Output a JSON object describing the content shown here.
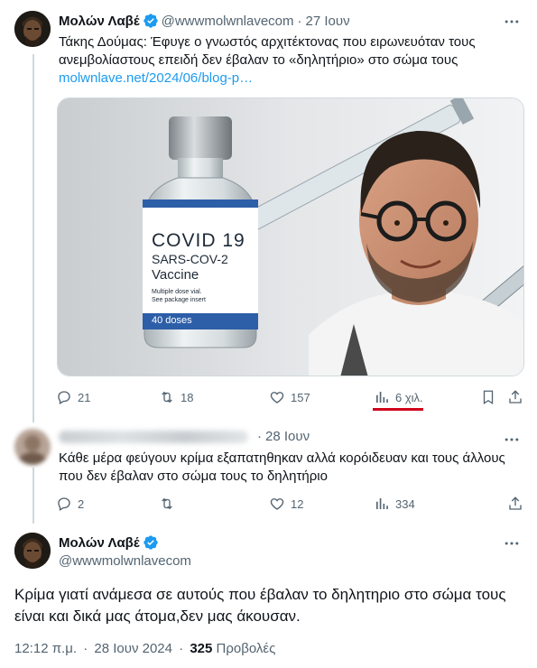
{
  "tweet1": {
    "name": "Μολών Λαβέ",
    "handle": "@wwwmolwnlavecom",
    "dot": "·",
    "date": "27 Ιουν",
    "text": "Τάκης Δούμας: Έφυγε ο γνωστός αρχιτέκτονας που ειρωνευόταν τους ανεμβολίαστους επειδή δεν έβαλαν το «δηλητήριο» στο σώμα τους",
    "link": "molwnlave.net/2024/06/blog-p…",
    "media": {
      "vial_line1": "COVID 19",
      "vial_line2": "SARS-COV-2",
      "vial_line3": "Vaccine",
      "vial_small1": "Multiple dose vial.",
      "vial_small2": "See package insert",
      "vial_doses": "40 doses"
    },
    "replies": "21",
    "retweets": "18",
    "likes": "157",
    "views": "6 χιλ."
  },
  "tweet2": {
    "date": "28 Ιουν",
    "dot": "·",
    "text": "Κάθε μέρα φεύγουν κρίμα εξαπατηθηκαν αλλά κορόιδευαν και τους άλλους που δεν έβαλαν στο σώμα τους το δηλητήριο",
    "replies": "2",
    "retweets": "",
    "likes": "12",
    "views": "334"
  },
  "tweet3": {
    "name": "Μολών Λαβέ",
    "handle": "@wwwmolwnlavecom",
    "text": "Κρίμα γιατί ανάμεσα σε αυτούς που έβαλαν το δηλητηριο στο σώμα τους είναι και δικά μας άτομα,δεν μας άκουσαν.",
    "time": "12:12 π.μ.",
    "dot": "·",
    "date": "28 Ιουν 2024",
    "dot2": "·",
    "views_count": "325",
    "views_label": "Προβολές"
  },
  "colors": {
    "accent": "#1d9bf0",
    "text": "#0f1419",
    "muted": "#536471",
    "highlight": "#d0021b"
  }
}
